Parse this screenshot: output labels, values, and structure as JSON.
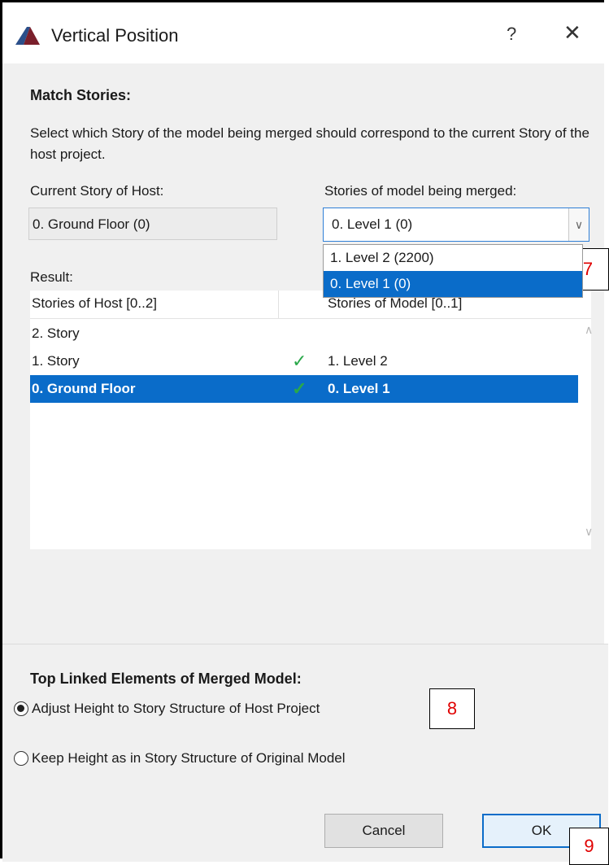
{
  "window": {
    "title": "Vertical Position",
    "help_label": "?",
    "close_label": "✕"
  },
  "match": {
    "heading": "Match Stories:",
    "description": "Select which Story of the model being merged should correspond to the current Story of the host project.",
    "host_label": "Current Story of Host:",
    "host_value": "0. Ground Floor (0)",
    "model_label": "Stories of model being merged:",
    "model_selected": "0. Level 1 (0)",
    "dropdown_options": [
      "1. Level 2 (2200)",
      "0. Level 1 (0)"
    ]
  },
  "result": {
    "label": "Result:",
    "col_host": "Stories of Host [0..2]",
    "col_model": "Stories of Model [0..1]",
    "rows": [
      {
        "host": "2. Story",
        "check": "",
        "model": ""
      },
      {
        "host": "1. Story",
        "check": "✓",
        "model": "1. Level 2"
      },
      {
        "host": "0. Ground Floor",
        "check": "✓",
        "model": "0. Level 1"
      }
    ]
  },
  "top_linked": {
    "heading": "Top Linked Elements of Merged Model:",
    "option_adjust": "Adjust Height to Story Structure of Host Project",
    "option_keep": "Keep Height as in Story Structure of Original Model"
  },
  "buttons": {
    "cancel": "Cancel",
    "ok": "OK"
  },
  "callouts": {
    "c7": "7",
    "c8": "8",
    "c9": "9"
  },
  "colors": {
    "accent": "#0a6cc9",
    "callout_text": "#e00000",
    "check": "#2aa84a"
  }
}
